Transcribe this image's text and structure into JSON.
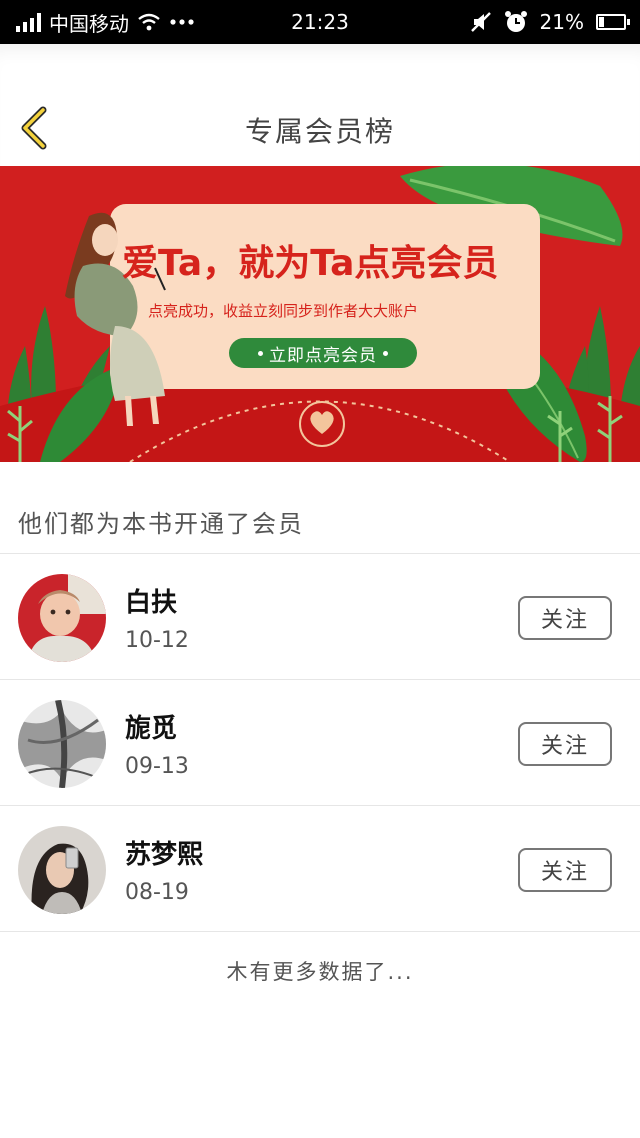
{
  "status_bar": {
    "carrier": "中国移动",
    "time": "21:23",
    "battery": "21%",
    "battery_level": 0.21,
    "icons": [
      "signal-icon",
      "wifi-icon",
      "more-dots-icon",
      "mute-icon",
      "alarm-icon",
      "battery-icon"
    ]
  },
  "header": {
    "title": "专属会员榜",
    "back_icon": "chevron-left-icon"
  },
  "banner": {
    "headline": "爱Ta，就为Ta点亮会员",
    "subtitle": "点亮成功，收益立刻同步到作者大大账户",
    "cta": "立即点亮会员",
    "colors": {
      "background": "#d11f1f",
      "card": "#fbdcc3",
      "cta": "#2f8a3b",
      "accent": "#d6231c"
    }
  },
  "section": {
    "title": "他们都为本书开通了会员"
  },
  "members": [
    {
      "name": "白扶",
      "date": "10-12",
      "follow_label": "关注"
    },
    {
      "name": "旎觅",
      "date": "09-13",
      "follow_label": "关注"
    },
    {
      "name": "苏梦熙",
      "date": "08-19",
      "follow_label": "关注"
    }
  ],
  "footer": {
    "no_more": "木有更多数据了..."
  }
}
